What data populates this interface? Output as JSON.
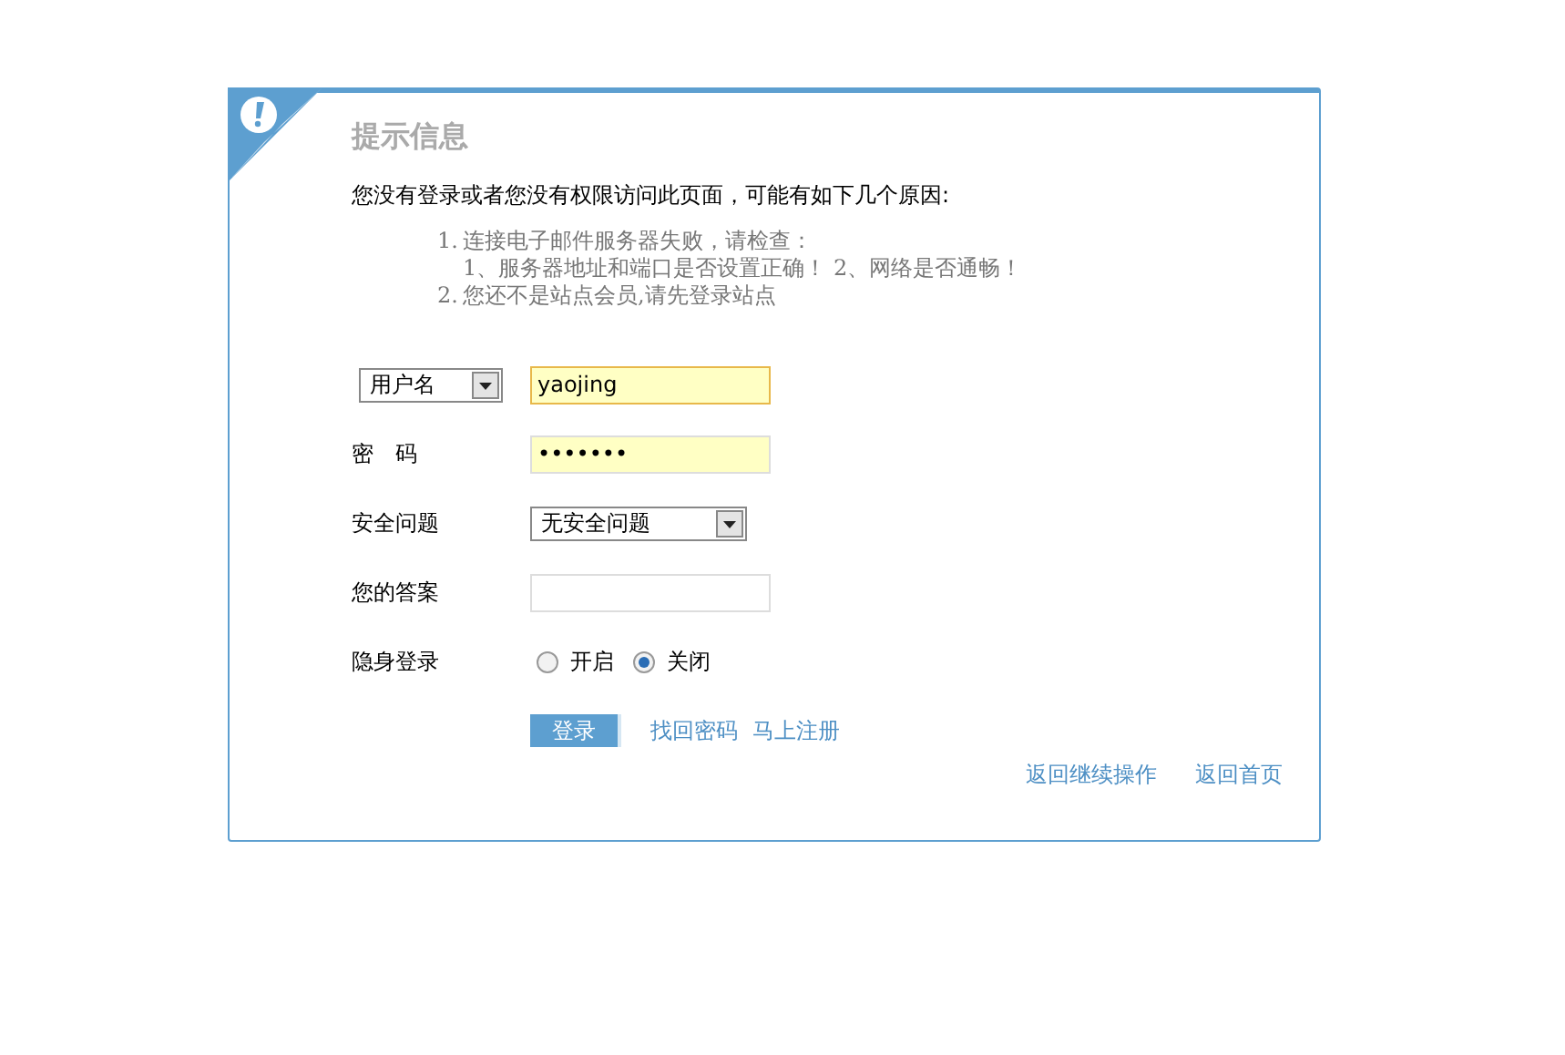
{
  "title": "提示信息",
  "message": "您没有登录或者您没有权限访问此页面，可能有如下几个原因:",
  "reasons": [
    {
      "number": "1.",
      "lines": [
        "连接电子邮件服务器失败，请检查：",
        "1、服务器地址和端口是否设置正确！ 2、网络是否通畅！"
      ]
    },
    {
      "number": "2.",
      "lines": [
        "您还不是站点会员,请先登录站点"
      ]
    }
  ],
  "form": [
    {
      "label_select": "用户名",
      "kind": "input",
      "value": "yaojing",
      "focused": true
    },
    {
      "label": "密　码",
      "kind": "input",
      "value": "•••••••",
      "focused": false
    },
    {
      "label": "安全问题",
      "kind": "select",
      "value": "无安全问题"
    },
    {
      "label": "您的答案",
      "kind": "input"
    },
    {
      "label": "隐身登录",
      "kind": "radio",
      "options": [
        {
          "label": "开启",
          "selected": false
        },
        {
          "label": "关闭",
          "selected": true
        }
      ]
    }
  ],
  "login_button": "登录",
  "links": [
    "找回密码",
    "马上注册"
  ],
  "footer_links": [
    "返回继续操作",
    "返回首页"
  ]
}
